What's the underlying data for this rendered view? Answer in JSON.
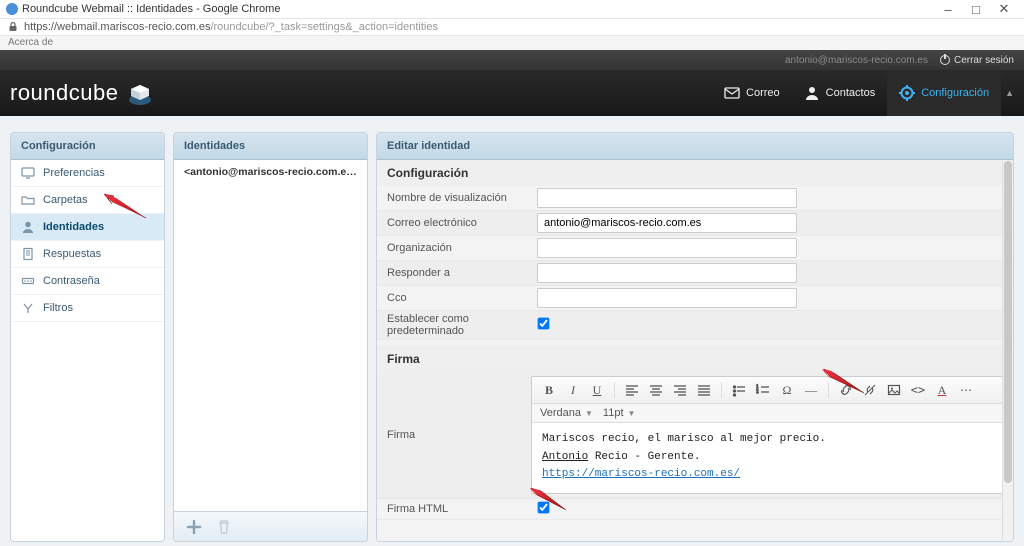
{
  "browser": {
    "title": "Roundcube Webmail :: Identidades - Google Chrome",
    "url_secure": "https://webmail.mariscos-recio.com.es",
    "url_path": "/roundcube/?_task=settings&_action=identities",
    "subtext": "Acerca de"
  },
  "topbar": {
    "username": "antonio@mariscos-recio.com.es",
    "signout": "Cerrar sesión"
  },
  "nav": {
    "logo": "roundcube",
    "mail": "Correo",
    "contacts": "Contactos",
    "settings": "Configuración"
  },
  "settings_menu": {
    "title": "Configuración",
    "items": [
      {
        "label": "Preferencias"
      },
      {
        "label": "Carpetas"
      },
      {
        "label": "Identidades"
      },
      {
        "label": "Respuestas"
      },
      {
        "label": "Contraseña"
      },
      {
        "label": "Filtros"
      }
    ]
  },
  "identities": {
    "title": "Identidades",
    "item": "<antonio@mariscos-recio.com.es>"
  },
  "edit": {
    "title": "Editar identidad",
    "section_config": "Configuración",
    "fields": {
      "display_name": {
        "label": "Nombre de visualización",
        "value": ""
      },
      "email": {
        "label": "Correo electrónico",
        "value": "antonio@mariscos-recio.com.es"
      },
      "organization": {
        "label": "Organización",
        "value": ""
      },
      "replyto": {
        "label": "Responder a",
        "value": ""
      },
      "bcc": {
        "label": "Cco",
        "value": ""
      },
      "setdefault": {
        "label": "Establecer como predeterminado"
      }
    },
    "section_signature": "Firma",
    "signature_label": "Firma",
    "htmlsig_label": "Firma HTML",
    "editor": {
      "font": "Verdana",
      "size": "11pt",
      "line1": "Mariscos recio, el marisco al mejor precio.",
      "line2a": "Antonio",
      "line2b": " Recio - Gerente.",
      "link": "https://mariscos-recio.com.es/"
    }
  }
}
